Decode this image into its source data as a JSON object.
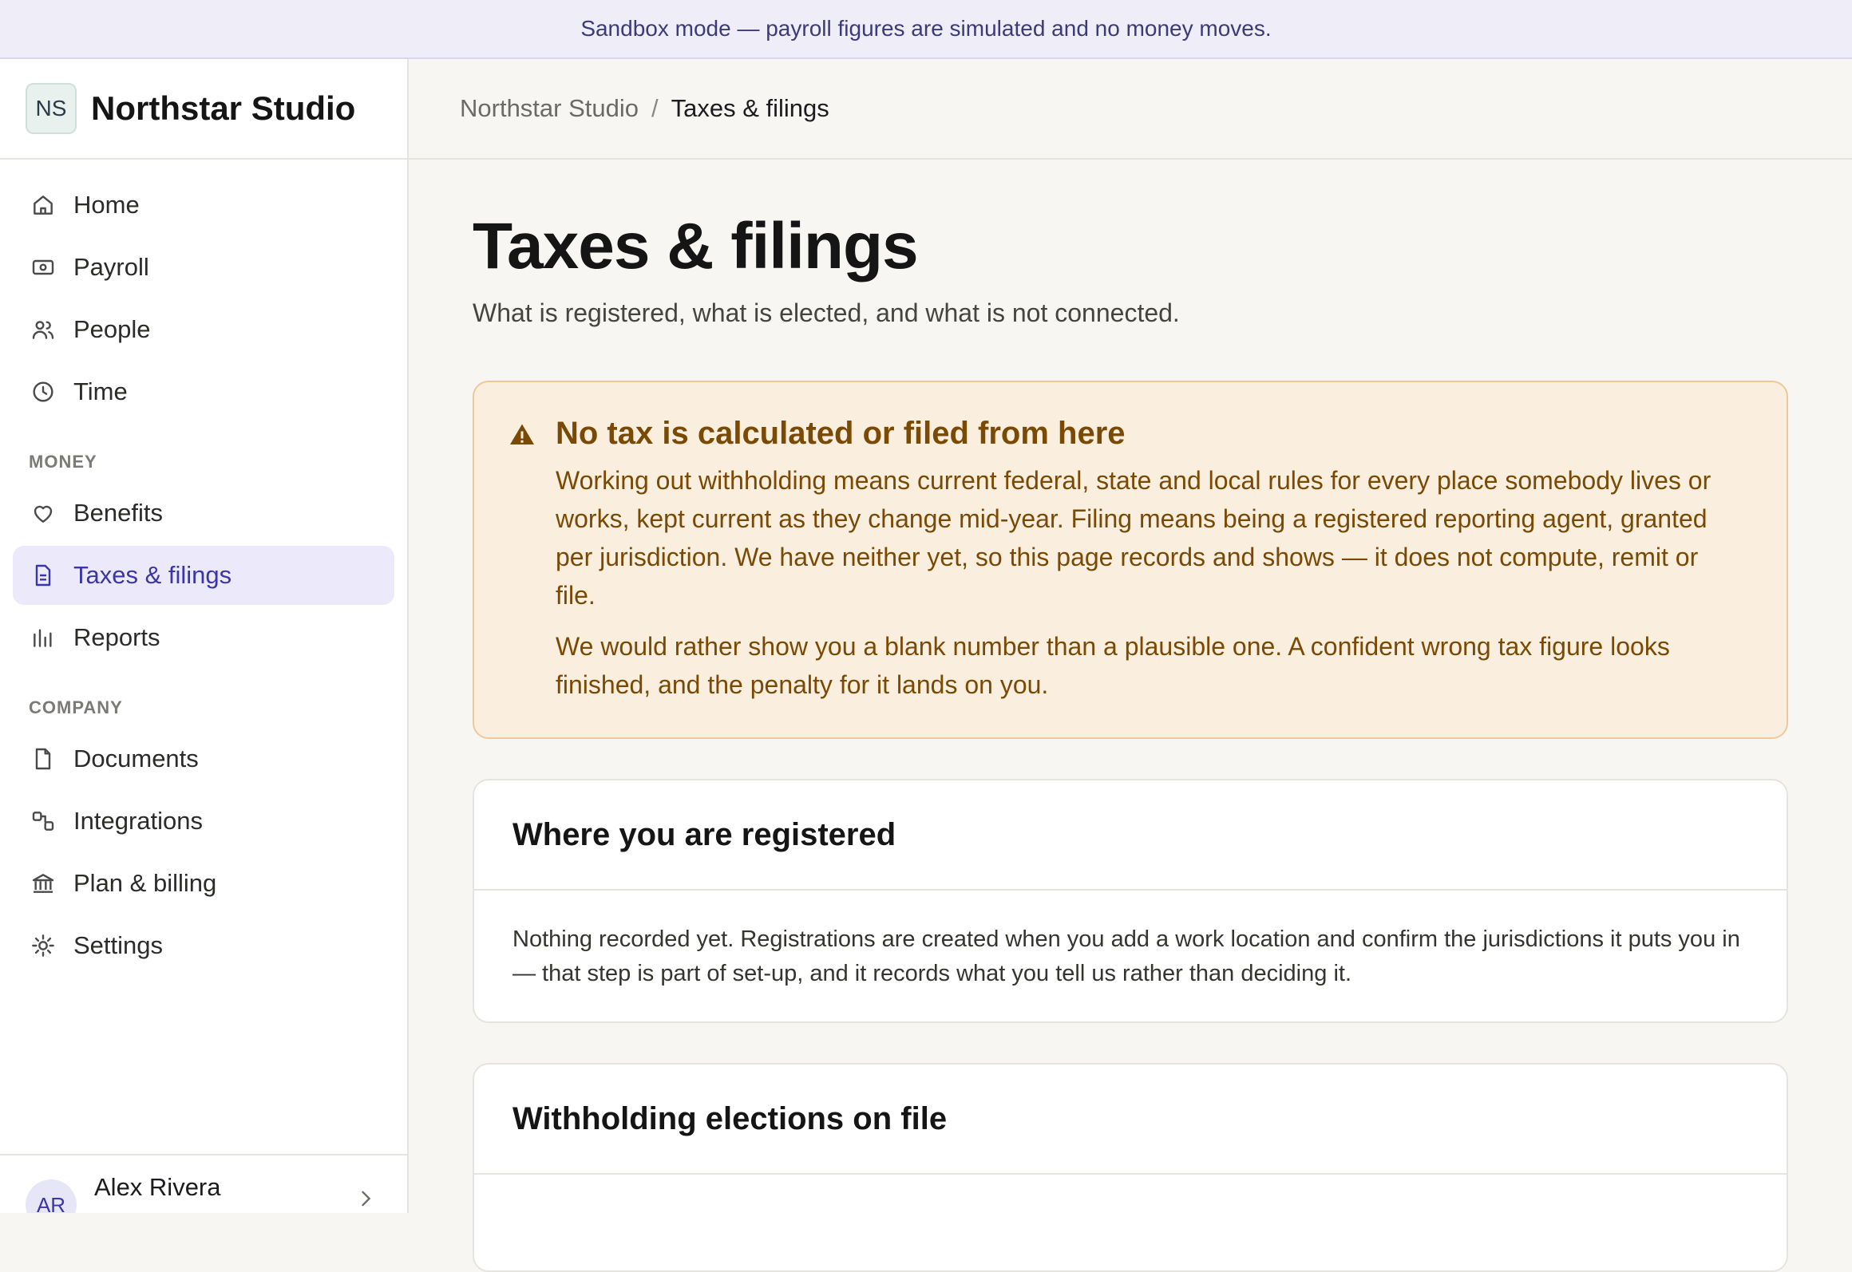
{
  "banner": {
    "text": "Sandbox mode — payroll figures are simulated and no money moves."
  },
  "sidebar": {
    "brand": {
      "initials": "NS",
      "name": "Northstar Studio"
    },
    "items_main": [
      {
        "label": "Home",
        "icon": "home-icon"
      },
      {
        "label": "Payroll",
        "icon": "banknote-icon"
      },
      {
        "label": "People",
        "icon": "people-icon"
      },
      {
        "label": "Time",
        "icon": "clock-icon"
      }
    ],
    "section_money": "MONEY",
    "items_money": [
      {
        "label": "Benefits",
        "icon": "heart-icon"
      },
      {
        "label": "Taxes & filings",
        "icon": "document-icon",
        "active": true
      },
      {
        "label": "Reports",
        "icon": "bar-chart-icon"
      }
    ],
    "section_company": "COMPANY",
    "items_company": [
      {
        "label": "Documents",
        "icon": "file-icon"
      },
      {
        "label": "Integrations",
        "icon": "integrations-icon"
      },
      {
        "label": "Plan & billing",
        "icon": "bank-icon"
      },
      {
        "label": "Settings",
        "icon": "gear-icon"
      }
    ],
    "user": {
      "initials": "AR",
      "name": "Alex Rivera"
    }
  },
  "breadcrumb": {
    "root": "Northstar Studio",
    "separator": "/",
    "current": "Taxes & filings"
  },
  "page": {
    "title": "Taxes & filings",
    "subtitle": "What is registered, what is elected, and what is not connected."
  },
  "notice": {
    "title": "No tax is calculated or filed from here",
    "paragraph1": "Working out withholding means current federal, state and local rules for every place somebody lives or works, kept current as they change mid-year. Filing means being a registered reporting agent, granted per jurisdiction. We have neither yet, so this page records and shows — it does not compute, remit or file.",
    "paragraph2": "We would rather show you a blank number than a plausible one. A confident wrong tax figure looks finished, and the penalty for it lands on you."
  },
  "registered": {
    "title": "Where you are registered",
    "body": "Nothing recorded yet. Registrations are created when you add a work location and confirm the jurisdictions it puts you in — that step is part of set-up, and it records what you tell us rather than deciding it."
  },
  "withholding": {
    "title": "Withholding elections on file"
  },
  "colors": {
    "accent": "#3a36a8",
    "warning_text": "#7a4a05",
    "warning_bg": "#faeedf"
  }
}
